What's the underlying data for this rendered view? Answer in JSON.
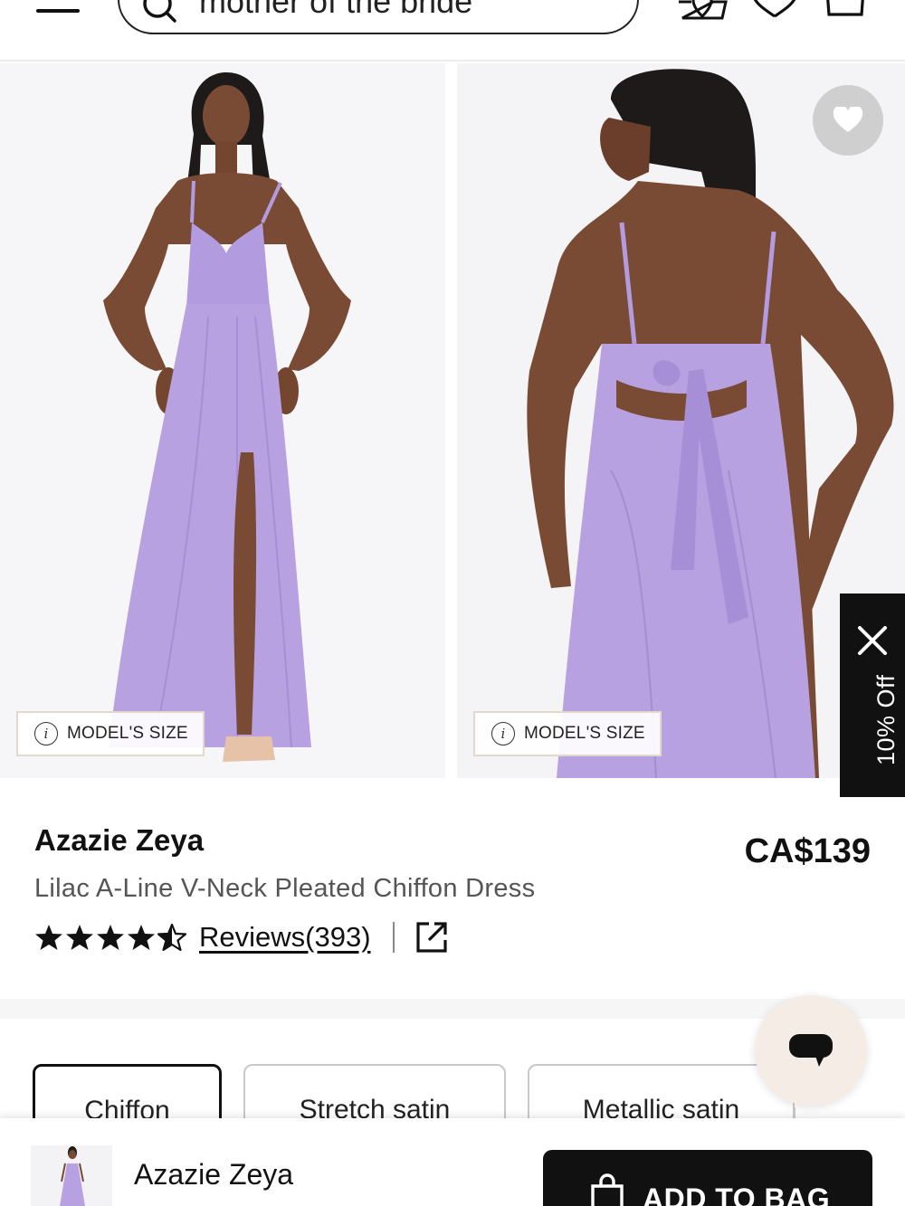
{
  "header": {
    "menu_icon": "hamburger-icon",
    "search": {
      "placeholder": "mother of the bride",
      "icon": "search-icon"
    },
    "icons": [
      "map-pin-icon",
      "heart-icon",
      "bag-icon"
    ]
  },
  "gallery": {
    "model_size_label": "MODEL'S SIZE",
    "info_glyph": "i",
    "dress_color": "#b7a1e0",
    "wishlist_icon": "heart-icon"
  },
  "promo": {
    "label": "10% Off",
    "close_icon": "close-icon"
  },
  "product": {
    "brand": "Azazie Zeya",
    "price": "CA$139",
    "subtitle": "Lilac A-Line V-Neck Pleated Chiffon Dress",
    "rating": 4.5,
    "reviews_label": "Reviews(393)",
    "share_icon": "external-link-icon"
  },
  "fabrics": {
    "options": [
      "Chiffon",
      "Stretch satin",
      "Metallic satin"
    ],
    "selected": "Chiffon"
  },
  "chat": {
    "icon": "chat-bubble-icon"
  },
  "sticky_bar": {
    "name": "Azazie Zeya",
    "add_label": "ADD TO BAG",
    "bag_icon": "shopping-bag-icon"
  },
  "colors": {
    "accent": "#111111",
    "lilac": "#b7a1e0",
    "chat_bg": "#f6ece6"
  }
}
